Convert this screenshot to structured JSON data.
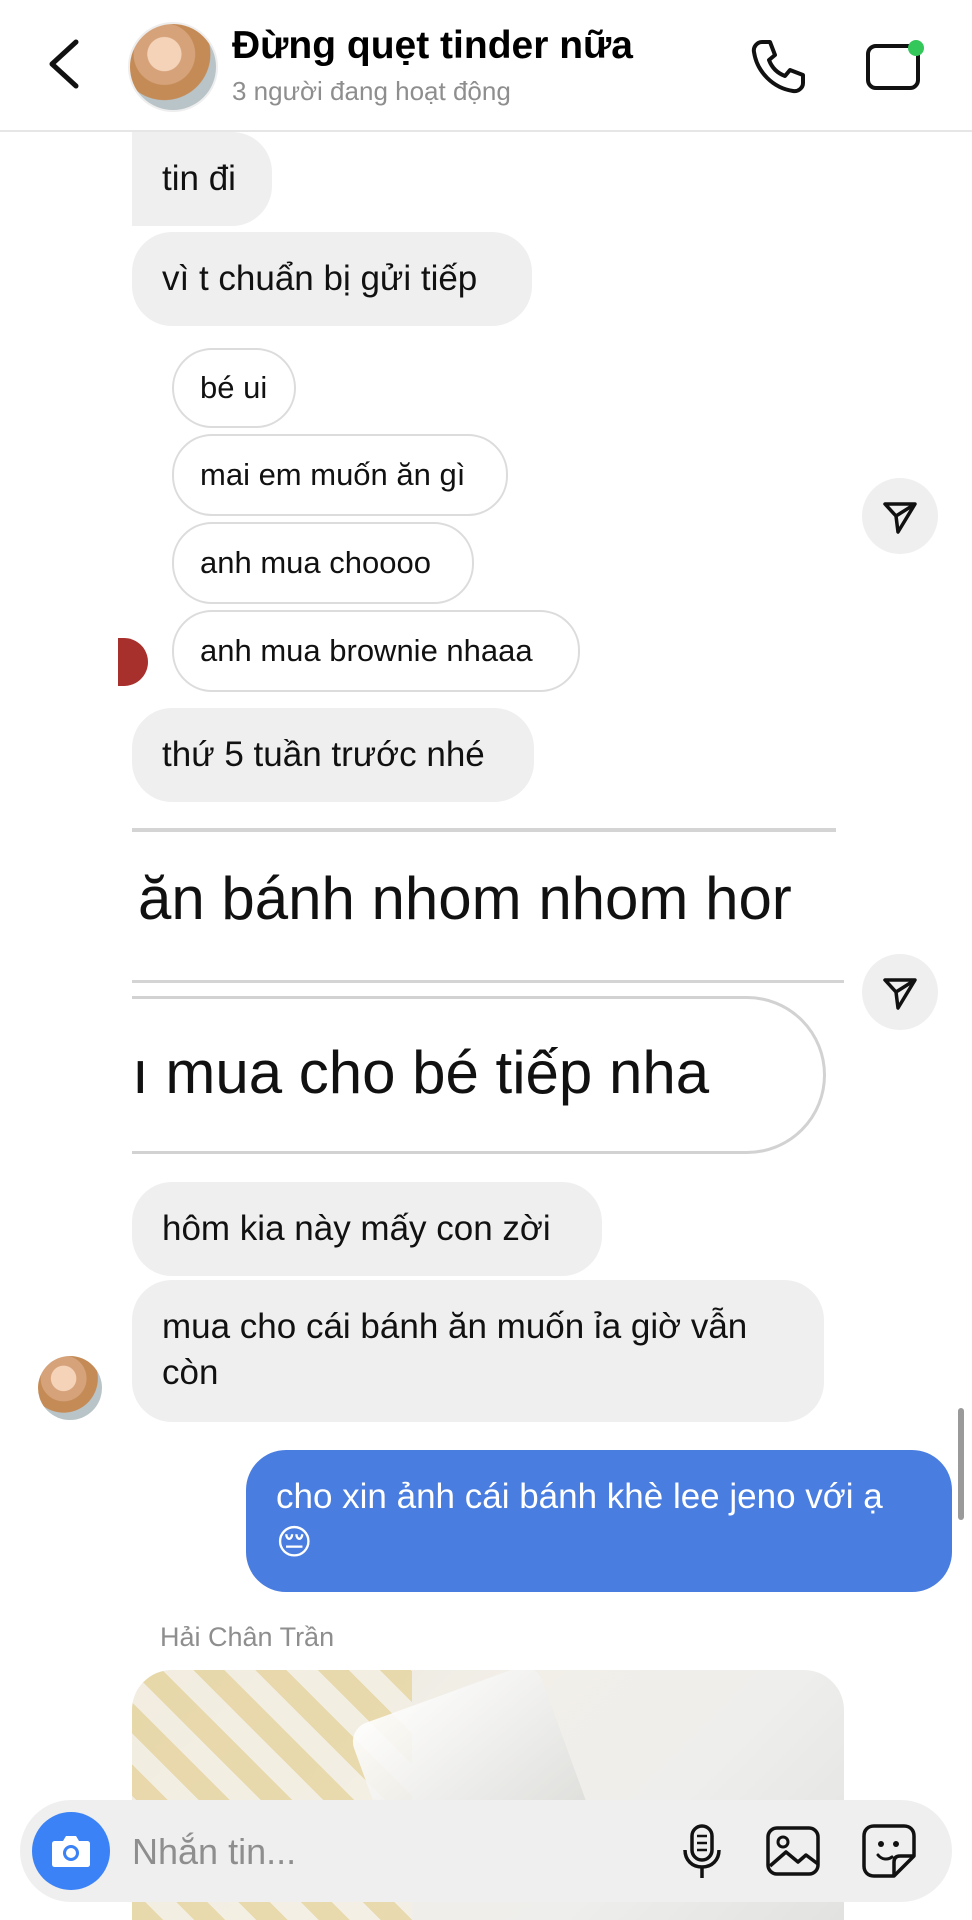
{
  "header": {
    "title": "Đừng quẹt tinder nữa",
    "subtitle": "3 người đang hoạt động"
  },
  "messages": {
    "m1": "tin đi",
    "m2": "vì t chuẩn bị gửi tiếp",
    "reply1": "bé ui",
    "reply2": "mai em muốn ăn gì",
    "reply3": "anh mua choooo",
    "reply4": "anh mua brownie nhaaa",
    "m3": "thứ 5 tuần trước nhé",
    "shot_line1": "ăn bánh nhom nhom hor",
    "shot_line2": "ı mua cho bé tiếp nha",
    "m4": "hôm kia này mấy con zời",
    "m5": "mua cho cái bánh ăn muốn ỉa giờ vẫn còn",
    "m6": "cho xin ảnh cái bánh khè lee jeno với ạ 😔",
    "sender": "Hải Chân Trần"
  },
  "composer": {
    "placeholder": "Nhắn tin..."
  },
  "colors": {
    "accent_blue": "#4a7de0",
    "camera_blue": "#3b82f6",
    "bubble_gray": "#efefef",
    "online_green": "#34c759"
  },
  "icons": [
    "chevron-left-icon",
    "phone-icon",
    "video-icon",
    "send-icon",
    "camera-icon",
    "mic-icon",
    "image-icon",
    "sticker-icon"
  ]
}
